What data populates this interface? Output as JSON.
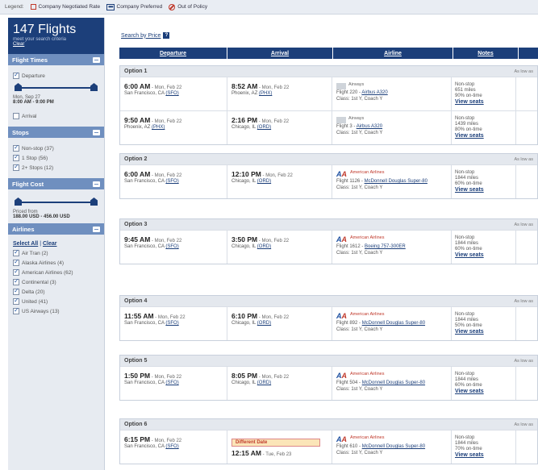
{
  "legend": {
    "title": "Legend:",
    "negotiated": "Company Negotiated Rate",
    "preferred": "Company Preferred",
    "out_of_policy": "Out of Policy"
  },
  "sidebar": {
    "count": "147 Flights",
    "subtitle": "meet your search criteria",
    "clear": "Clear",
    "flight_times": {
      "title": "Flight Times",
      "departure_label": "Departure",
      "range_date": "Mon, Sep 27",
      "range_time": "8:00 AM - 9:00 PM",
      "arrival_label": "Arrival"
    },
    "stops": {
      "title": "Stops",
      "items": [
        "Non-stop (37)",
        "1 Stop (56)",
        "2+ Stops (12)"
      ]
    },
    "flight_cost": {
      "title": "Flight Cost",
      "priced_from": "Priced from",
      "range": "188.00 USD - 456.00 USD"
    },
    "airlines": {
      "title": "Airlines",
      "select_all": "Select All",
      "sep": "|",
      "clear": "Clear",
      "items": [
        "Air Tran (2)",
        "Alaska Airlines (4)",
        "American Airlines (62)",
        "Continental (3)",
        "Delta (20)",
        "United (41)",
        "US Airways (13)"
      ]
    }
  },
  "main": {
    "search_by_price": "Search by Price",
    "help_icon": "?",
    "columns": [
      "Departure",
      "Arrival",
      "Airline",
      "Notes"
    ],
    "lowest": "As low as",
    "options": [
      {
        "title": "Option 1",
        "rows": [
          {
            "dep_time": "6:00 AM",
            "dep_date": " - Mon, Feb 22",
            "dep_city": "San Francisco, CA ",
            "dep_code": "(SFO)",
            "arr_time": "8:52 AM",
            "arr_date": " - Mon, Feb 22",
            "arr_city": "Phoenix, AZ ",
            "arr_code": "(PHX)",
            "airline_logo": "US",
            "airline_name": "Airways",
            "flight": "Flight 220 - ",
            "aircraft": "Airbus A320",
            "class": "Class: 1st Y, Coach Y",
            "stops": "Non-stop",
            "miles": "651 miles",
            "ontime": "90% on-time",
            "view": "View seats"
          },
          {
            "dep_time": "9:50 AM",
            "dep_date": " - Mon, Feb 22",
            "dep_city": "Phoenix, AZ ",
            "dep_code": "(PHX)",
            "arr_time": "2:16 PM",
            "arr_date": " - Mon, Feb 22",
            "arr_city": "Chicago, IL ",
            "arr_code": "(ORD)",
            "airline_logo": "US",
            "airline_name": "Airways",
            "flight": "Flight 3 - ",
            "aircraft": "Airbus A320",
            "class": "Class: 1st Y, Coach Y",
            "stops": "Non-stop",
            "miles": "1439 miles",
            "ontime": "80% on-time",
            "view": "View seats"
          }
        ]
      },
      {
        "title": "Option 2",
        "rows": [
          {
            "dep_time": "6:00 AM",
            "dep_date": " - Mon, Feb 22",
            "dep_city": "San Francisco, CA ",
            "dep_code": "(SFO)",
            "arr_time": "12:10 PM",
            "arr_date": " - Mon, Feb 22",
            "arr_city": "Chicago, IL ",
            "arr_code": "(ORD)",
            "airline_logo": "AA",
            "airline_name": "American Airlines",
            "flight": "Flight 1126 - ",
            "aircraft": "McDonnell Douglas Super-80",
            "class": "Class: 1st Y, Coach Y",
            "stops": "Non-stop",
            "miles": "1844 miles",
            "ontime": "60% on-time",
            "view": "View seats"
          }
        ]
      },
      {
        "title": "Option 3",
        "rows": [
          {
            "dep_time": "9:45 AM",
            "dep_date": " - Mon, Feb 22",
            "dep_city": "San Francisco, CA ",
            "dep_code": "(SFO)",
            "arr_time": "3:50 PM",
            "arr_date": " - Mon, Feb 22",
            "arr_city": "Chicago, IL ",
            "arr_code": "(ORD)",
            "airline_logo": "AA",
            "airline_name": "American Airlines",
            "flight": "Flight 1612 - ",
            "aircraft": "Boeing 757-300ER",
            "class": "Class: 1st Y, Coach Y",
            "stops": "Non-stop",
            "miles": "1844 miles",
            "ontime": "60% on-time",
            "view": "View seats"
          }
        ]
      },
      {
        "title": "Option 4",
        "rows": [
          {
            "dep_time": "11:55 AM",
            "dep_date": " - Mon, Feb 22",
            "dep_city": "San Francisco, CA ",
            "dep_code": "(SFO)",
            "arr_time": "6:10 PM",
            "arr_date": " - Mon, Feb 22",
            "arr_city": "Chicago, IL ",
            "arr_code": "(ORD)",
            "airline_logo": "AA",
            "airline_name": "American Airlines",
            "flight": "Flight 892 - ",
            "aircraft": "McDonnell Douglas Super-80",
            "class": "Class: 1st Y, Coach Y",
            "stops": "Non-stop",
            "miles": "1844 miles",
            "ontime": "50% on-time",
            "view": "View seats"
          }
        ]
      },
      {
        "title": "Option 5",
        "rows": [
          {
            "dep_time": "1:50 PM",
            "dep_date": " - Mon, Feb 22",
            "dep_city": "San Francisco, CA ",
            "dep_code": "(SFO)",
            "arr_time": "8:05 PM",
            "arr_date": " - Mon, Feb 22",
            "arr_city": "Chicago, IL ",
            "arr_code": "(ORD)",
            "airline_logo": "AA",
            "airline_name": "American Airlines",
            "flight": "Flight 504 - ",
            "aircraft": "McDonnell Douglas Super-80",
            "class": "Class: 1st Y, Coach Y",
            "stops": "Non-stop",
            "miles": "1844 miles",
            "ontime": "60% on-time",
            "view": "View seats"
          }
        ]
      },
      {
        "title": "Option 6",
        "rows": [
          {
            "dep_time": "6:15 PM",
            "dep_date": " - Mon, Feb 22",
            "dep_city": "San Francisco, CA ",
            "dep_code": "(SFO)",
            "diff_date": "Different Date",
            "arr_time": "12:15 AM",
            "arr_date": " - Tue, Feb 23",
            "arr_city": "",
            "arr_code": "",
            "airline_logo": "AA",
            "airline_name": "American Airlines",
            "flight": "Flight 610 - ",
            "aircraft": "McDonnell Douglas Super-80",
            "class": "Class: 1st Y, Coach Y",
            "stops": "Non-stop",
            "miles": "1844 miles",
            "ontime": "70% on-time",
            "view": "View seats"
          }
        ]
      }
    ]
  }
}
